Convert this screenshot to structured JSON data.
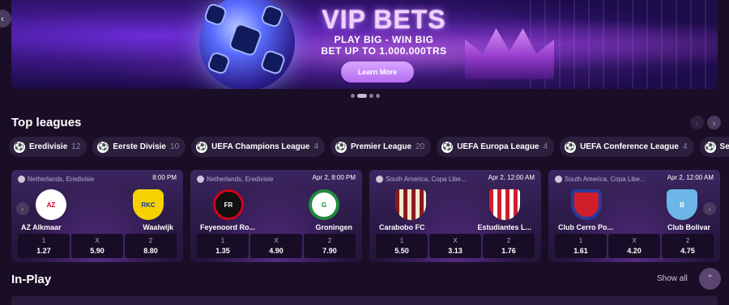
{
  "banner": {
    "title": "VIP BETS",
    "subtitle1": "PLAY BIG - WIN BIG",
    "subtitle2": "BET UP TO 1.000.000TRS",
    "button": "Learn More",
    "prev_icon": "chevron-left-icon"
  },
  "top_leagues": {
    "title": "Top leagues",
    "items": [
      {
        "name": "Eredivisie",
        "count": "12"
      },
      {
        "name": "Eerste Divisie",
        "count": "10"
      },
      {
        "name": "UEFA Champions League",
        "count": "4"
      },
      {
        "name": "Premier League",
        "count": "20"
      },
      {
        "name": "UEFA Europa League",
        "count": "4"
      },
      {
        "name": "UEFA Conference League",
        "count": "4"
      },
      {
        "name": "Ser",
        "count": ""
      }
    ]
  },
  "matches": [
    {
      "league": "Netherlands, Eredivisie",
      "time": "8:00 PM",
      "home": "AZ Alkmaar",
      "away": "Waalwijk",
      "odds": [
        {
          "k": "1",
          "v": "1.27"
        },
        {
          "k": "X",
          "v": "5.90"
        },
        {
          "k": "2",
          "v": "8.80"
        }
      ],
      "home_color": "#e0001b",
      "away_color": "#f5d200"
    },
    {
      "league": "Netherlands, Eredivisie",
      "time": "Apr 2, 8:00 PM",
      "home": "Feyenoord Ro...",
      "away": "Groningen",
      "odds": [
        {
          "k": "1",
          "v": "1.35"
        },
        {
          "k": "X",
          "v": "4.90"
        },
        {
          "k": "2",
          "v": "7.90"
        }
      ],
      "home_color": "#d4001c",
      "away_color": "#1e8a3c"
    },
    {
      "league": "South America, Copa Libe...",
      "time": "Apr 2, 12:00 AM",
      "home": "Carabobo FC",
      "away": "Estudiantes L...",
      "odds": [
        {
          "k": "1",
          "v": "5.50"
        },
        {
          "k": "X",
          "v": "3.13"
        },
        {
          "k": "2",
          "v": "1.76"
        }
      ],
      "home_color": "#8a1a1a",
      "away_color": "#d01f2a"
    },
    {
      "league": "South America, Copa Libe...",
      "time": "Apr 2, 12:00 AM",
      "home": "Club Cerro Po...",
      "away": "Club Bolivar",
      "odds": [
        {
          "k": "1",
          "v": "1.61"
        },
        {
          "k": "X",
          "v": "4.20"
        },
        {
          "k": "2",
          "v": "4.75"
        }
      ],
      "home_color": "#2a3a9a",
      "away_color": "#6cb6e8"
    }
  ],
  "in_play": {
    "title": "In-Play",
    "show_all": "Show all"
  }
}
